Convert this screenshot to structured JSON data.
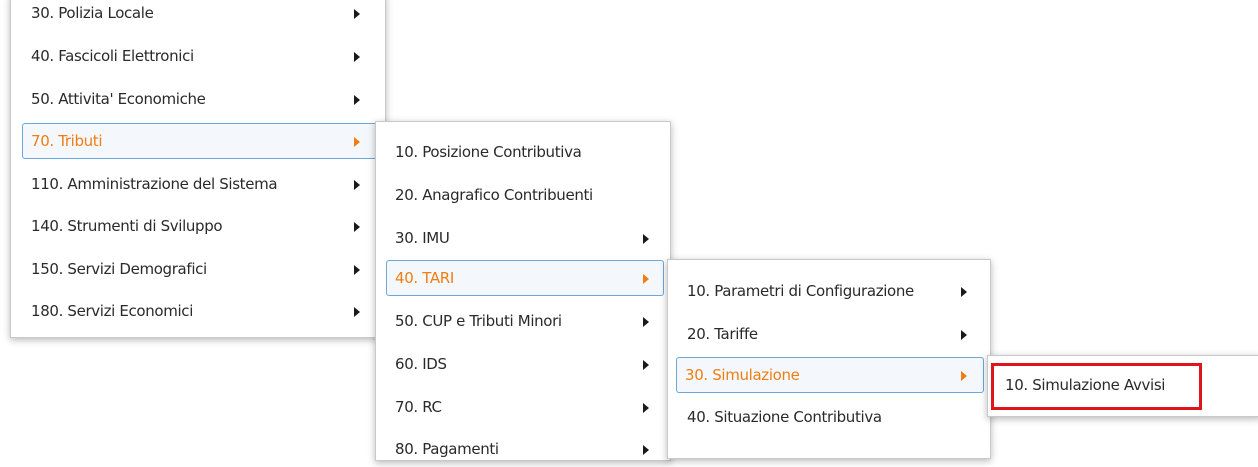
{
  "colors": {
    "active_text": "#f07d12",
    "active_border": "#6aa8da",
    "highlight": "#e0141b"
  },
  "menu1": {
    "items": [
      {
        "label": "30. Polizia Locale",
        "has_submenu": true
      },
      {
        "label": "40. Fascicoli Elettronici",
        "has_submenu": true
      },
      {
        "label": "50. Attivita' Economiche",
        "has_submenu": true
      },
      {
        "label": "70. Tributi",
        "has_submenu": true,
        "active": true
      },
      {
        "label": "110. Amministrazione del Sistema",
        "has_submenu": true
      },
      {
        "label": "140. Strumenti di Sviluppo",
        "has_submenu": true
      },
      {
        "label": "150. Servizi Demografici",
        "has_submenu": true
      },
      {
        "label": "180. Servizi Economici",
        "has_submenu": true
      }
    ]
  },
  "menu2": {
    "items": [
      {
        "label": "10. Posizione Contributiva",
        "has_submenu": false
      },
      {
        "label": "20. Anagrafico Contribuenti",
        "has_submenu": false
      },
      {
        "label": "30. IMU",
        "has_submenu": true
      },
      {
        "label": "40. TARI",
        "has_submenu": true,
        "active": true
      },
      {
        "label": "50. CUP e Tributi Minori",
        "has_submenu": true
      },
      {
        "label": "60. IDS",
        "has_submenu": true
      },
      {
        "label": "70. RC",
        "has_submenu": true
      },
      {
        "label": "80. Pagamenti",
        "has_submenu": true
      }
    ]
  },
  "menu3": {
    "items": [
      {
        "label": "10. Parametri di Configurazione",
        "has_submenu": true
      },
      {
        "label": "20. Tariffe",
        "has_submenu": true
      },
      {
        "label": "30. Simulazione",
        "has_submenu": true,
        "active": true
      },
      {
        "label": "40. Situazione Contributiva",
        "has_submenu": false
      }
    ]
  },
  "menu4": {
    "items": [
      {
        "label": "10. Simulazione Avvisi",
        "has_submenu": false,
        "highlighted": true
      }
    ]
  }
}
